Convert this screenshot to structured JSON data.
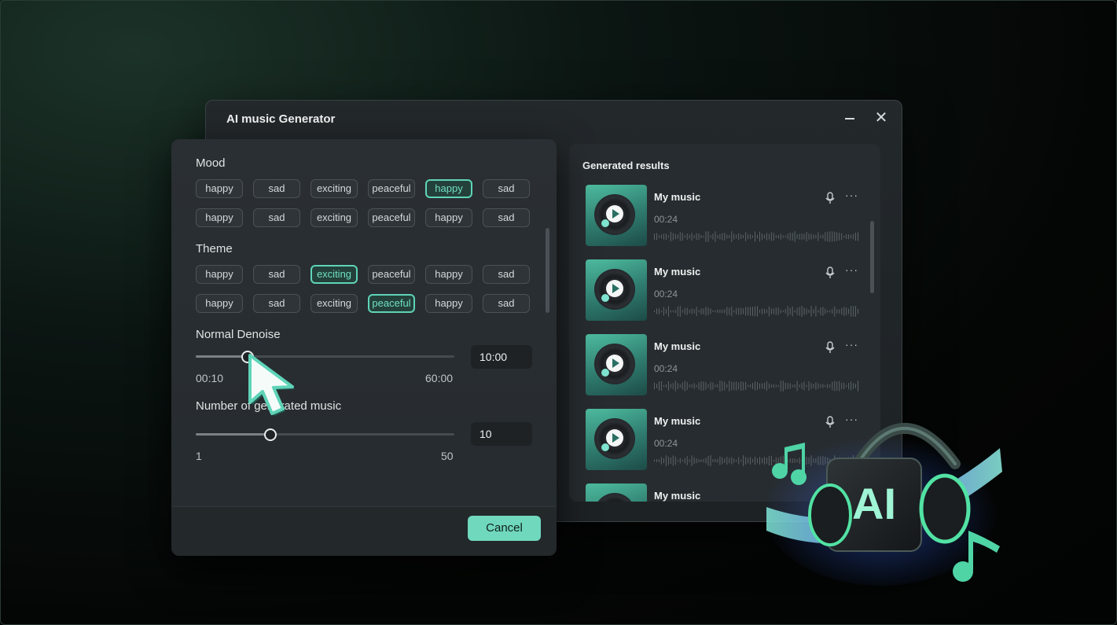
{
  "window": {
    "title": "AI music Generator"
  },
  "mood": {
    "label": "Mood",
    "row1": [
      "happy",
      "sad",
      "exciting",
      "peaceful",
      "happy",
      "sad"
    ],
    "row2": [
      "happy",
      "sad",
      "exciting",
      "peaceful",
      "happy",
      "sad"
    ]
  },
  "theme": {
    "label": "Theme",
    "row1": [
      "happy",
      "sad",
      "exciting",
      "peaceful",
      "happy",
      "sad"
    ],
    "row2": [
      "happy",
      "sad",
      "exciting",
      "peaceful",
      "happy",
      "sad"
    ]
  },
  "denoise": {
    "label": "Normal Denoise",
    "min": "00:10",
    "max": "60:00",
    "value": "10:00",
    "level": 0.2
  },
  "count": {
    "label": "Number of generated music",
    "min": "1",
    "max": "50",
    "value": "10",
    "level": 0.29
  },
  "footer": {
    "cancel": "Cancel"
  },
  "results": {
    "title": "Generated results",
    "items": [
      {
        "name": "My music",
        "time": "00:24"
      },
      {
        "name": "My music",
        "time": "00:24"
      },
      {
        "name": "My music",
        "time": "00:24"
      },
      {
        "name": "My music",
        "time": "00:24"
      },
      {
        "name": "My music",
        "time": ""
      }
    ]
  },
  "art": {
    "text": "AI"
  },
  "colors": {
    "accent": "#6fd8bd",
    "selected_chip_border": "#5fd4b8",
    "panel": "#2a2f33"
  }
}
